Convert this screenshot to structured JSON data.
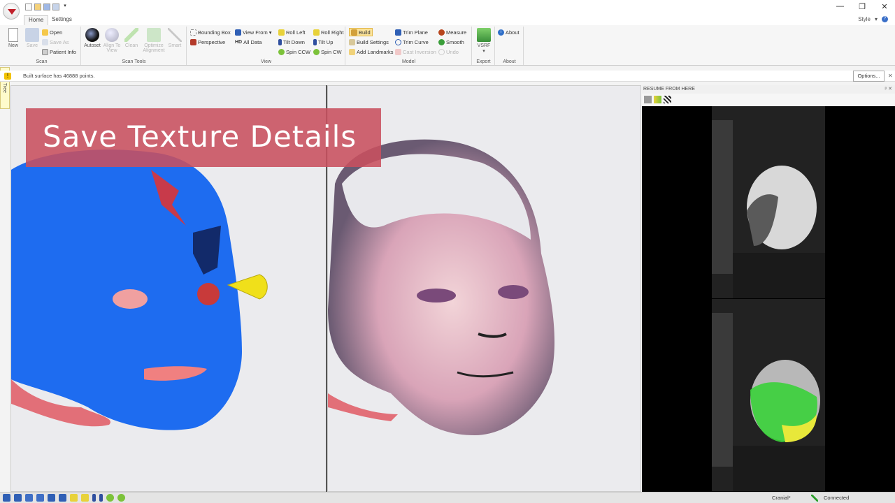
{
  "quick_access": {
    "icons": [
      "new-icon",
      "open-icon",
      "save-icon",
      "save-as-icon"
    ],
    "dropdown": "▾"
  },
  "window": {
    "minimize": "—",
    "restore": "❐",
    "close": "✕"
  },
  "tabs": [
    {
      "label": "Home",
      "active": true
    },
    {
      "label": "Settings",
      "active": false
    }
  ],
  "style_menu": {
    "label": "Style",
    "arrow": "▾",
    "help": "?"
  },
  "ribbon": {
    "scan": {
      "label": "Scan",
      "new": "New",
      "save": "Save",
      "open": "Open",
      "save_as": "Save As",
      "patient_info": "Patient Info"
    },
    "scan_tools": {
      "label": "Scan Tools",
      "autoset": "Autoset",
      "align_to_view": "Align To View",
      "clean": "Clean",
      "optimize_alignment": "Optimize Alignment",
      "smart": "Smart"
    },
    "view": {
      "label": "View",
      "bounding_box": "Bounding Box",
      "perspective": "Perspective",
      "view_from": "View From",
      "view_from_arrow": "▾",
      "all_data": "All Data",
      "hd_badge": "HD",
      "roll_left": "Roll Left",
      "tilt_down": "Tilt Down",
      "spin_ccw": "Spin CCW",
      "roll_right": "Roll Right",
      "tilt_up": "Tilt Up",
      "spin_cw": "Spin CW"
    },
    "model": {
      "label": "Model",
      "build": "Build",
      "build_settings": "Build Settings",
      "add_landmarks": "Add Landmarks",
      "trim_plane": "Trim Plane",
      "trim_curve": "Trim Curve",
      "cast_inversion": "Cast Inversion",
      "measure": "Measure",
      "smooth": "Smooth",
      "undo": "Undo"
    },
    "export": {
      "label": "Export",
      "vsrf": "VSRF",
      "vsrf_arrow": "▾"
    },
    "about": {
      "label": "About",
      "about": "About",
      "about_icon": "i"
    }
  },
  "infobar": {
    "icon": "!",
    "message": "Built surface has 46888 points.",
    "options": "Options...",
    "close": "✕"
  },
  "scan_tree": {
    "label": "Scan Tree"
  },
  "overlay": {
    "title": "Save Texture Details"
  },
  "resume_panel": {
    "title": "RESUME FROM HERE",
    "controls": "ᵖ ✕"
  },
  "status": {
    "mode": "Cranial*",
    "connection": "Connected"
  },
  "colors": {
    "accent": "#c0202a",
    "banner": "#c8505f",
    "model_blue": "#1e6cf0",
    "arrow_yellow": "#f0e01a",
    "connected_green": "#2ea02e"
  }
}
